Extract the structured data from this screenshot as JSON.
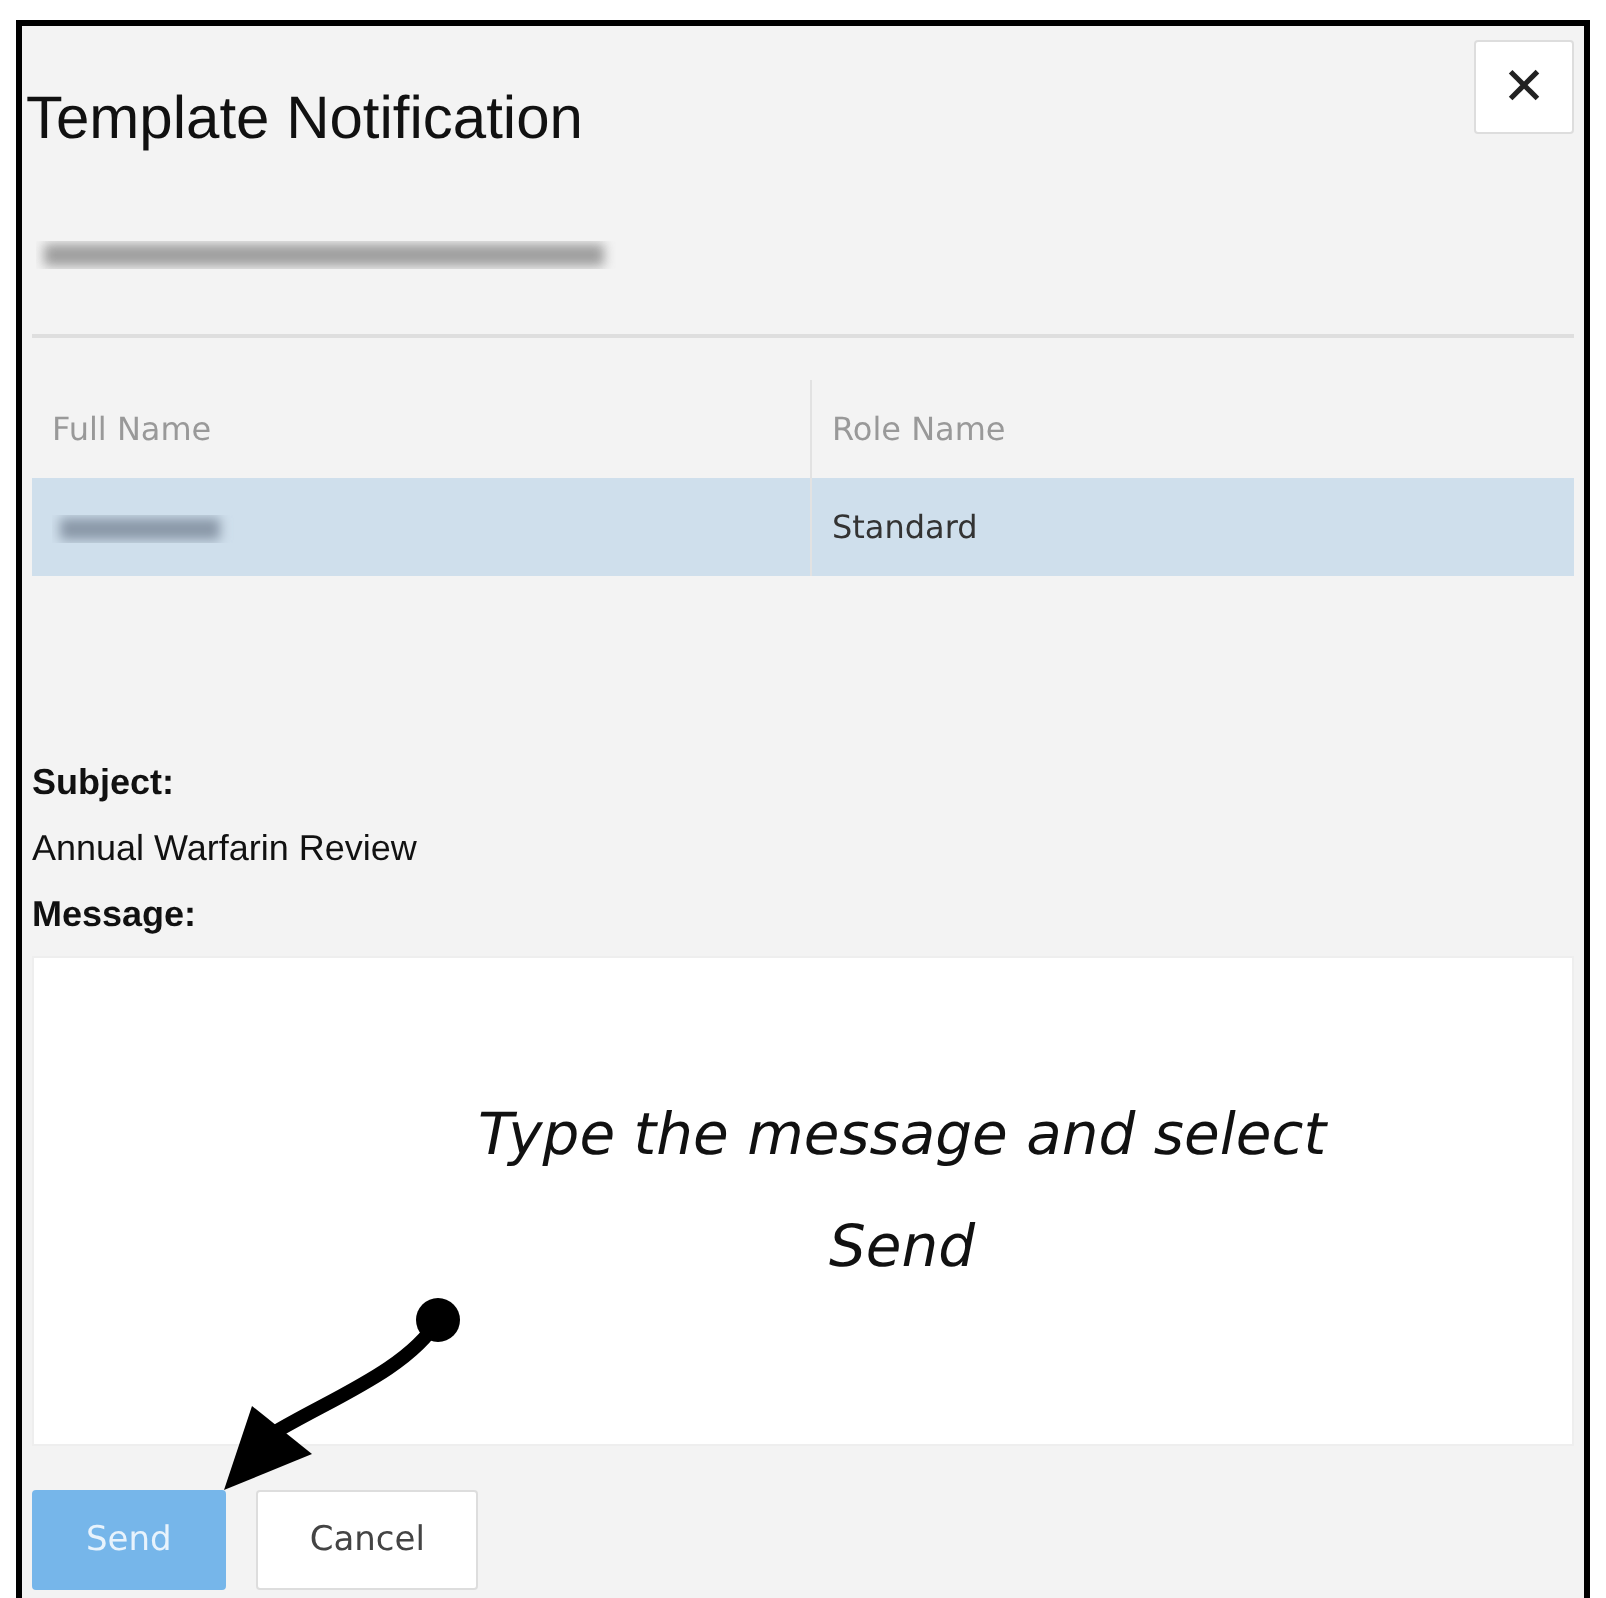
{
  "dialog": {
    "title": "Template Notification",
    "close": "✕"
  },
  "table": {
    "columns": [
      "Full Name",
      "Role Name"
    ],
    "rows": [
      {
        "role": "Standard",
        "selected": true
      }
    ]
  },
  "subject": {
    "label": "Subject:",
    "value": "Annual Warfarin Review"
  },
  "message": {
    "label": "Message:"
  },
  "annotation": [
    "Type the message and select",
    "Send"
  ],
  "buttons": [
    {
      "label": "Send",
      "kind": "primary",
      "disabled": true
    },
    {
      "label": "Cancel",
      "kind": "secondary",
      "disabled": false
    }
  ]
}
